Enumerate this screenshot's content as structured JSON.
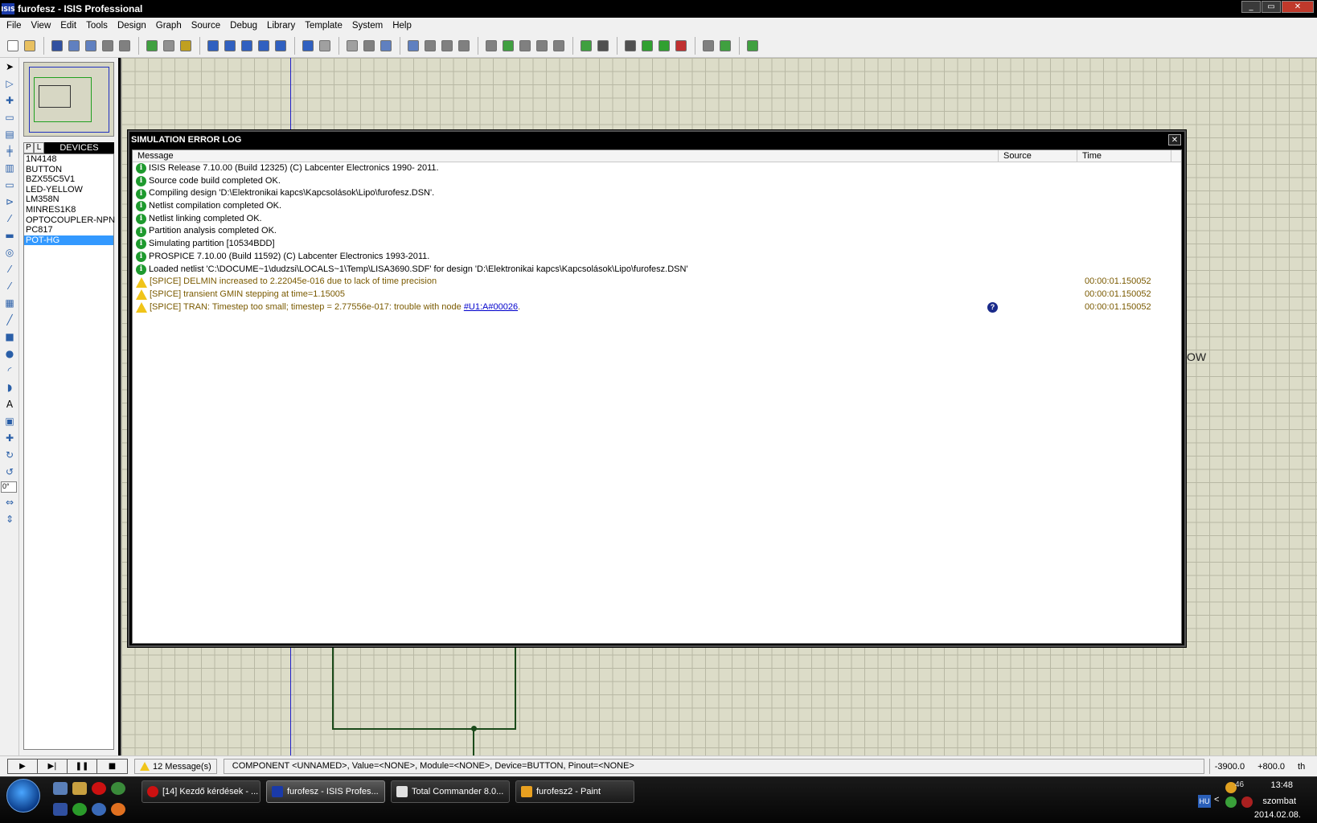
{
  "window": {
    "app_icon": "ISIS",
    "title": "furofesz - ISIS Professional",
    "controls": [
      "_",
      "▭",
      "✕"
    ]
  },
  "menu": [
    "File",
    "View",
    "Edit",
    "Tools",
    "Design",
    "Graph",
    "Source",
    "Debug",
    "Library",
    "Template",
    "System",
    "Help"
  ],
  "toolbar_icons": [
    "new-icon",
    "open-icon",
    "save-icon",
    "import-icon",
    "export-icon",
    "print-icon",
    "print-area-icon",
    "refresh-icon",
    "grid-icon",
    "origin-icon",
    "pan-icon",
    "zoom-in-icon",
    "zoom-out-icon",
    "zoom-all-icon",
    "zoom-area-icon",
    "undo-icon",
    "redo-icon",
    "cut-icon",
    "copy-icon",
    "paste-icon",
    "block-copy-icon",
    "block-move-icon",
    "block-rotate-icon",
    "block-delete-icon",
    "pick-device-icon",
    "make-device-icon",
    "packaging-icon",
    "decompose-icon",
    "wire-autorouter-icon",
    "search-tag-icon",
    "property-tool-icon",
    "new-sheet-icon",
    "remove-sheet-icon",
    "exit-to-parent-icon",
    "bom-icon",
    "erc-icon",
    "netlist-ares-icon",
    "ares-icon"
  ],
  "left_tools": [
    "selection-icon",
    "component-icon",
    "junction-icon",
    "wire-label-icon",
    "text-script-icon",
    "buses-icon",
    "subcircuit-icon",
    "terminals-icon",
    "device-pins-icon",
    "graph-icon",
    "tape-recorder-icon",
    "generator-icon",
    "voltage-probe-icon",
    "current-probe-icon",
    "virtual-instruments-icon",
    "line-icon",
    "box-icon",
    "circle-icon",
    "arc-icon",
    "path-icon",
    "text-icon",
    "symbol-icon",
    "marker-icon",
    "rotate-cw-icon",
    "rotate-ccw-icon",
    "flip-horizontal-icon",
    "flip-vertical-icon"
  ],
  "rotation_value": "0°",
  "device_panel": {
    "tab_p": "P",
    "tab_l": "L",
    "header": "DEVICES",
    "items": [
      "1N4148",
      "BUTTON",
      "BZX55C5V1",
      "LED-YELLOW",
      "LM358N",
      "MINRES1K8",
      "OPTOCOUPLER-NPN",
      "PC817",
      "POT-HG"
    ],
    "selected": "POT-HG"
  },
  "canvas": {
    "partial_label": "OW",
    "colors": {
      "grid": "#dcdcc8",
      "wire": "#1a4a1a",
      "sheet_border": "#2020c8"
    }
  },
  "error_log": {
    "title": "SIMULATION ERROR LOG",
    "close": "✕",
    "columns": {
      "message": "Message",
      "source": "Source",
      "time": "Time"
    },
    "rows": [
      {
        "type": "info",
        "message": "ISIS Release 7.10.00 (Build 12325) (C) Labcenter Electronics 1990- 2011.",
        "time": ""
      },
      {
        "type": "info",
        "message": "Source code build completed OK.",
        "time": ""
      },
      {
        "type": "info",
        "message": "Compiling design 'D:\\Elektronikai kapcs\\Kapcsolások\\Lipo\\furofesz.DSN'.",
        "time": ""
      },
      {
        "type": "info",
        "message": "Netlist compilation completed OK.",
        "time": ""
      },
      {
        "type": "info",
        "message": "Netlist linking completed OK.",
        "time": ""
      },
      {
        "type": "info",
        "message": "Partition analysis completed OK.",
        "time": ""
      },
      {
        "type": "info",
        "message": "Simulating partition [10534BDD]",
        "time": ""
      },
      {
        "type": "info",
        "message": "PROSPICE 7.10.00 (Build 11592) (C) Labcenter Electronics 1993-2011.",
        "time": ""
      },
      {
        "type": "info",
        "message": "Loaded netlist 'C:\\DOCUME~1\\dudzsi\\LOCALS~1\\Temp\\LISA3690.SDF' for design 'D:\\Elektronikai kapcs\\Kapcsolások\\Lipo\\furofesz.DSN'",
        "time": ""
      },
      {
        "type": "warn",
        "message": "[SPICE] DELMIN increased to 2.22045e-016 due to lack of time precision",
        "time": "00:00:01.150052"
      },
      {
        "type": "warn",
        "message": "[SPICE] transient GMIN stepping at time=1.15005",
        "time": "00:00:01.150052"
      },
      {
        "type": "warn",
        "message": "[SPICE] TRAN:  Timestep too small; timestep = 2.77556e-017: trouble with node ",
        "link": "#U1:A#00026",
        "suffix": ".",
        "help": "?",
        "time": "00:00:01.150052"
      }
    ],
    "icon_info": "i"
  },
  "status": {
    "sim_controls": [
      "play-icon",
      "step-icon",
      "pause-icon",
      "stop-icon"
    ],
    "message_count": "12 Message(s)",
    "text": "COMPONENT <UNNAMED>, Value=<NONE>, Module=<NONE>, Device=BUTTON, Pinout=<NONE>",
    "x": "-3900.0",
    "y": "+800.0",
    "unit": "th"
  },
  "taskbar": {
    "buttons": [
      {
        "label": "[14] Kezdő kérdések - ...",
        "icon_color": "#cc1111",
        "active": false
      },
      {
        "label": "furofesz - ISIS Profes...",
        "icon_color": "#1a3aa8",
        "active": true
      },
      {
        "label": "Total Commander 8.0...",
        "icon_color": "#e0e0e0",
        "active": false
      },
      {
        "label": "furofesz2 - Paint",
        "icon_color": "#e8a020",
        "active": false
      }
    ],
    "tray": {
      "lang": "HU",
      "count": "46",
      "time": "13:48",
      "day": "szombat",
      "date": "2014.02.08."
    }
  }
}
